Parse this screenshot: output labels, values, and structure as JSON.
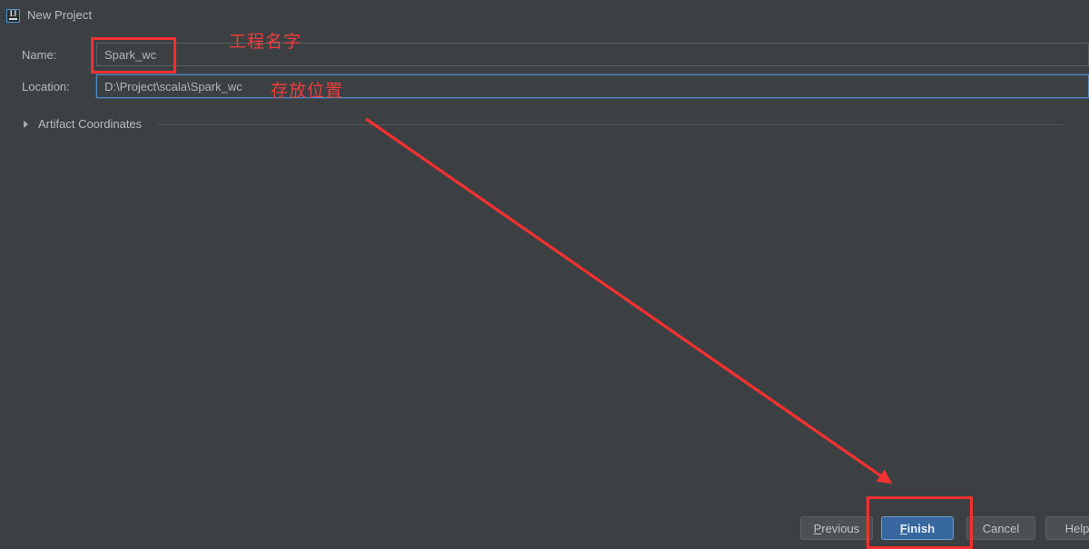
{
  "dialog": {
    "title": "New Project",
    "icon": "intellij-idea-icon"
  },
  "form": {
    "name_label": "Name:",
    "name_value": "Spark_wc",
    "location_label": "Location:",
    "location_value": "D:\\Project\\scala\\Spark_wc",
    "artifact_section_label": "Artifact Coordinates",
    "artifact_section_expanded": "false"
  },
  "buttons": {
    "previous": {
      "mnemonic": "P",
      "rest": "revious"
    },
    "finish": {
      "mnemonic": "F",
      "rest": "inish"
    },
    "cancel": "Cancel",
    "help": "Help"
  },
  "annotations": {
    "name_note": "工程名字",
    "location_note": "存放位置",
    "highlight_color": "#f73030",
    "arrow_color": "#f73030",
    "arrow_from": "403,131",
    "arrow_to": "982,534"
  },
  "colors": {
    "dialog_background": "#3c4043",
    "input_border": "#5c6164",
    "focused_input_border": "#4a88c7",
    "primary_button": "#37679f",
    "text": "#b6bbc0"
  }
}
